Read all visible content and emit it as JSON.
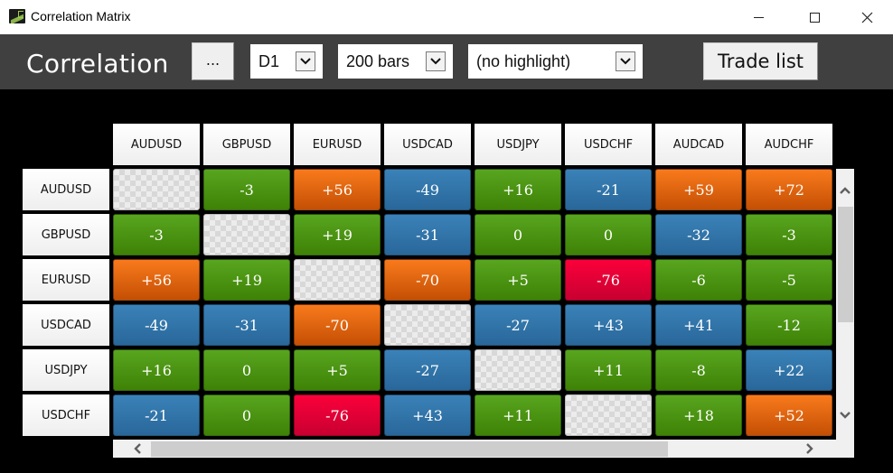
{
  "window": {
    "title": "Correlation Matrix",
    "controls": {
      "minimize": "minimize",
      "maximize": "maximize",
      "close": "close"
    }
  },
  "toolbar": {
    "title": "Correlation",
    "more_label": "...",
    "timeframe": "D1",
    "bars": "200 bars",
    "highlight": "(no highlight)",
    "trade_list_label": "Trade list"
  },
  "colors": {
    "green": "#4e951a",
    "blue": "#3278ad",
    "orange": "#e9650f",
    "red": "#e4003a",
    "toolbar_bg": "#404040"
  },
  "matrix": {
    "columns": [
      "AUDUSD",
      "GBPUSD",
      "EURUSD",
      "USDCAD",
      "USDJPY",
      "USDCHF",
      "AUDCAD",
      "AUDCHF"
    ],
    "rows": [
      {
        "symbol": "AUDUSD",
        "cells": [
          {
            "v": "",
            "c": "diag"
          },
          {
            "v": "-3",
            "c": "green"
          },
          {
            "v": "+56",
            "c": "orange"
          },
          {
            "v": "-49",
            "c": "blue"
          },
          {
            "v": "+16",
            "c": "green"
          },
          {
            "v": "-21",
            "c": "blue"
          },
          {
            "v": "+59",
            "c": "orange"
          },
          {
            "v": "+72",
            "c": "orange"
          }
        ]
      },
      {
        "symbol": "GBPUSD",
        "cells": [
          {
            "v": "-3",
            "c": "green"
          },
          {
            "v": "",
            "c": "diag"
          },
          {
            "v": "+19",
            "c": "green"
          },
          {
            "v": "-31",
            "c": "blue"
          },
          {
            "v": "0",
            "c": "green"
          },
          {
            "v": "0",
            "c": "green"
          },
          {
            "v": "-32",
            "c": "blue"
          },
          {
            "v": "-3",
            "c": "green"
          }
        ]
      },
      {
        "symbol": "EURUSD",
        "cells": [
          {
            "v": "+56",
            "c": "orange"
          },
          {
            "v": "+19",
            "c": "green"
          },
          {
            "v": "",
            "c": "diag"
          },
          {
            "v": "-70",
            "c": "orange"
          },
          {
            "v": "+5",
            "c": "green"
          },
          {
            "v": "-76",
            "c": "red"
          },
          {
            "v": "-6",
            "c": "green"
          },
          {
            "v": "-5",
            "c": "green"
          }
        ]
      },
      {
        "symbol": "USDCAD",
        "cells": [
          {
            "v": "-49",
            "c": "blue"
          },
          {
            "v": "-31",
            "c": "blue"
          },
          {
            "v": "-70",
            "c": "orange"
          },
          {
            "v": "",
            "c": "diag"
          },
          {
            "v": "-27",
            "c": "blue"
          },
          {
            "v": "+43",
            "c": "blue"
          },
          {
            "v": "+41",
            "c": "blue"
          },
          {
            "v": "-12",
            "c": "green"
          }
        ]
      },
      {
        "symbol": "USDJPY",
        "cells": [
          {
            "v": "+16",
            "c": "green"
          },
          {
            "v": "0",
            "c": "green"
          },
          {
            "v": "+5",
            "c": "green"
          },
          {
            "v": "-27",
            "c": "blue"
          },
          {
            "v": "",
            "c": "diag"
          },
          {
            "v": "+11",
            "c": "green"
          },
          {
            "v": "-8",
            "c": "green"
          },
          {
            "v": "+22",
            "c": "blue"
          }
        ]
      },
      {
        "symbol": "USDCHF",
        "cells": [
          {
            "v": "-21",
            "c": "blue"
          },
          {
            "v": "0",
            "c": "green"
          },
          {
            "v": "-76",
            "c": "red"
          },
          {
            "v": "+43",
            "c": "blue"
          },
          {
            "v": "+11",
            "c": "green"
          },
          {
            "v": "",
            "c": "diag"
          },
          {
            "v": "+18",
            "c": "green"
          },
          {
            "v": "+52",
            "c": "orange"
          }
        ]
      }
    ],
    "partial_row_colors": [
      "orange",
      "blue",
      "green",
      "blue",
      "green",
      "green",
      "diag",
      "orange"
    ],
    "partial_col_colors": [
      "red",
      "green",
      "blue",
      "orange",
      "orange",
      "green"
    ]
  },
  "scrollbars": {
    "vertical": {
      "position_fraction": 0.0,
      "visible_fraction": 0.5
    },
    "horizontal": {
      "position_fraction": 0.0,
      "visible_fraction": 0.7
    }
  }
}
